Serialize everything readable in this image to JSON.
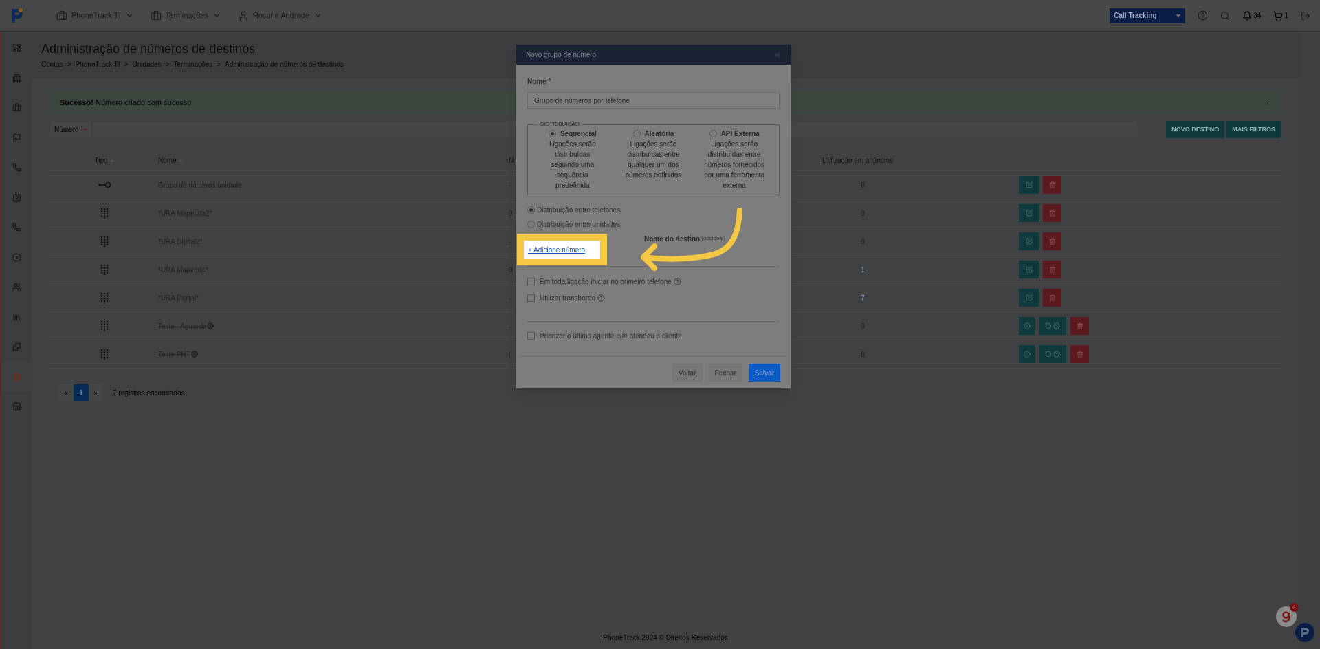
{
  "topbar": {
    "nav": [
      {
        "label": "PhoneTrack TI",
        "kind": "briefcase"
      },
      {
        "label": "Terminações",
        "kind": "briefcase"
      },
      {
        "label": "Rosane Andrade",
        "kind": "user"
      }
    ],
    "product_select": {
      "value": "Call Tracking"
    },
    "notifications": "34",
    "cart": "1"
  },
  "sidebar": {
    "items": [
      {
        "selected": false
      },
      {
        "selected": false
      },
      {
        "selected": false
      },
      {
        "selected": false
      },
      {
        "selected": false
      },
      {
        "selected": false
      },
      {
        "selected": false
      },
      {
        "selected": false
      },
      {
        "selected": false
      },
      {
        "selected": false
      },
      {
        "selected": false
      },
      {
        "selected": true
      },
      {
        "selected": false
      }
    ]
  },
  "page": {
    "title": "Administração de números de destinos",
    "breadcrumb_separator": ">",
    "breadcrumb": [
      "Contas",
      "PhoneTrack TI",
      "Unidades",
      "Terminações",
      "Administração de números de destinos"
    ]
  },
  "alert": {
    "title": "Sucesso!",
    "message": "Número criado com sucesso"
  },
  "filter": {
    "field": "Número"
  },
  "buttons": [
    "NOVO DESTINO",
    "MAIS FILTROS"
  ],
  "table": {
    "columns": [
      "Tipo",
      "Nome",
      "N",
      "Utilização em anúncios"
    ],
    "rows": [
      {
        "kind": "group",
        "name": "Grupo de números unidade",
        "column_3": "-",
        "usage": "0",
        "usage_link": false,
        "disabled": false
      },
      {
        "kind": "ura",
        "name": "*URA Mapeada2*",
        "column_3": "0",
        "usage": "0",
        "usage_link": false,
        "disabled": false
      },
      {
        "kind": "ura",
        "name": "*URA Digital2*",
        "column_3": "-",
        "usage": "0",
        "usage_link": false,
        "disabled": false
      },
      {
        "kind": "ura",
        "name": "*URA Mapeada*",
        "column_3": "0",
        "usage": "1",
        "usage_link": true,
        "disabled": false
      },
      {
        "kind": "ura",
        "name": "*URA Digital*",
        "column_3": "-",
        "usage": "7",
        "usage_link": true,
        "disabled": false
      },
      {
        "kind": "ura",
        "name": "Teste - Aguarde",
        "column_3": "-",
        "usage": "0",
        "usage_link": false,
        "disabled": true
      },
      {
        "kind": "ura",
        "name": "Teste PHT",
        "column_3": "(",
        "usage": "0",
        "usage_link": false,
        "disabled": true
      }
    ]
  },
  "pagination": {
    "previous": "«",
    "next": "»",
    "pages": [
      {
        "label": "1",
        "selected": true
      }
    ],
    "summary": "7 registros encontrados"
  },
  "footer": "PhoneTrack 2024 © Direitos Reservados",
  "chat_badge": "4",
  "modal": {
    "title": "Novo grupo de número",
    "name_label": "Nome *",
    "name_value": "Grupo de números por telefone",
    "distribution_legend": "DISTRIBUIÇÃO",
    "distribution": [
      {
        "label": "Sequencial",
        "description": "Ligações serão distribuídas seguindo uma sequência predefinida",
        "selected": true
      },
      {
        "label": "Aleatória",
        "description": "Ligações serão distribuídas entre qualquer um dos números definidos",
        "selected": false
      },
      {
        "label": "API Externa",
        "description": "Ligações serão distribuídas entre números fornecidos por uma ferramenta externa",
        "selected": false
      }
    ],
    "targets": [
      {
        "label": "Distribuição entre telefones",
        "selected": true
      },
      {
        "label": "Distribuição entre unidades",
        "selected": false
      }
    ],
    "destination_header": "Nome do destino",
    "destination_hint": "(opcional)",
    "add_link": "+ Adicione número",
    "options": [
      {
        "label": "Em toda ligação iniciar no primeiro telefone",
        "checked": false,
        "help": true
      },
      {
        "label": "Utilizar transbordo",
        "checked": false,
        "help": true
      }
    ],
    "priority": {
      "label": "Priorizar o último agente que atendeu o cliente",
      "checked": false
    },
    "actions": [
      {
        "label": "Voltar",
        "kind": "secondary"
      },
      {
        "label": "Fechar",
        "kind": "secondary"
      },
      {
        "label": "Salvar",
        "kind": "primary"
      }
    ]
  }
}
